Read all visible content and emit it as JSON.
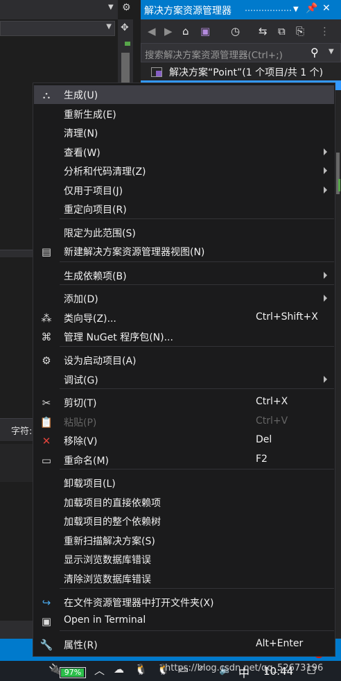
{
  "solution_explorer": {
    "title": "解决方案资源管理器",
    "search_placeholder": "搜索解决方案资源管理器(Ctrl+;)",
    "solution_node": "解决方案“Point”(1 个项目/共 1 个)"
  },
  "bottom_panel": {
    "char_label": "字符:"
  },
  "context_menu": {
    "items": [
      {
        "label": "生成(U)",
        "shortcut": "",
        "submenu": false,
        "icon": "build-icon",
        "disabled": false
      },
      {
        "label": "重新生成(E)",
        "shortcut": "",
        "submenu": false,
        "icon": "",
        "disabled": false
      },
      {
        "label": "清理(N)",
        "shortcut": "",
        "submenu": false,
        "icon": "",
        "disabled": false
      },
      {
        "label": "查看(W)",
        "shortcut": "",
        "submenu": true,
        "icon": "",
        "disabled": false
      },
      {
        "label": "分析和代码清理(Z)",
        "shortcut": "",
        "submenu": true,
        "icon": "",
        "disabled": false
      },
      {
        "label": "仅用于项目(J)",
        "shortcut": "",
        "submenu": true,
        "icon": "",
        "disabled": false
      },
      {
        "label": "重定向项目(R)",
        "shortcut": "",
        "submenu": false,
        "icon": "",
        "disabled": false
      },
      {
        "label": "限定为此范围(S)",
        "shortcut": "",
        "submenu": false,
        "icon": "",
        "disabled": false
      },
      {
        "label": "新建解决方案资源管理器视图(N)",
        "shortcut": "",
        "submenu": false,
        "icon": "new-view-icon",
        "disabled": false
      },
      {
        "label": "生成依赖项(B)",
        "shortcut": "",
        "submenu": true,
        "icon": "",
        "disabled": false
      },
      {
        "label": "添加(D)",
        "shortcut": "",
        "submenu": true,
        "icon": "",
        "disabled": false
      },
      {
        "label": "类向导(Z)...",
        "shortcut": "Ctrl+Shift+X",
        "submenu": false,
        "icon": "class-wizard-icon",
        "disabled": false
      },
      {
        "label": "管理 NuGet 程序包(N)...",
        "shortcut": "",
        "submenu": false,
        "icon": "nuget-icon",
        "disabled": false
      },
      {
        "label": "设为启动项目(A)",
        "shortcut": "",
        "submenu": false,
        "icon": "gear-icon",
        "disabled": false
      },
      {
        "label": "调试(G)",
        "shortcut": "",
        "submenu": true,
        "icon": "",
        "disabled": false
      },
      {
        "label": "剪切(T)",
        "shortcut": "Ctrl+X",
        "submenu": false,
        "icon": "scissors-icon",
        "disabled": false
      },
      {
        "label": "粘贴(P)",
        "shortcut": "Ctrl+V",
        "submenu": false,
        "icon": "paste-icon",
        "disabled": true
      },
      {
        "label": "移除(V)",
        "shortcut": "Del",
        "submenu": false,
        "icon": "remove-icon",
        "disabled": false
      },
      {
        "label": "重命名(M)",
        "shortcut": "F2",
        "submenu": false,
        "icon": "rename-icon",
        "disabled": false
      },
      {
        "label": "卸载项目(L)",
        "shortcut": "",
        "submenu": false,
        "icon": "",
        "disabled": false
      },
      {
        "label": "加载项目的直接依赖项",
        "shortcut": "",
        "submenu": false,
        "icon": "",
        "disabled": false
      },
      {
        "label": "加载项目的整个依赖树",
        "shortcut": "",
        "submenu": false,
        "icon": "",
        "disabled": false
      },
      {
        "label": "重新扫描解决方案(S)",
        "shortcut": "",
        "submenu": false,
        "icon": "",
        "disabled": false
      },
      {
        "label": "显示浏览数据库错误",
        "shortcut": "",
        "submenu": false,
        "icon": "",
        "disabled": false
      },
      {
        "label": "清除浏览数据库错误",
        "shortcut": "",
        "submenu": false,
        "icon": "",
        "disabled": false
      },
      {
        "label": "在文件资源管理器中打开文件夹(X)",
        "shortcut": "",
        "submenu": false,
        "icon": "refresh-arrow-icon",
        "disabled": false
      },
      {
        "label": "Open in Terminal",
        "shortcut": "",
        "submenu": false,
        "icon": "terminal-icon",
        "disabled": false
      },
      {
        "label": "属性(R)",
        "shortcut": "Alt+Enter",
        "submenu": false,
        "icon": "wrench-icon",
        "disabled": false
      }
    ]
  },
  "taskbar": {
    "battery_text": "97%",
    "battery_level": 0.97,
    "language": "中",
    "time": "10:44"
  },
  "watermark": "https://blog.csdn.net/qq_52673196",
  "colors": {
    "accent": "#007acc",
    "menu_bg": "#1b1b1c",
    "highlight": "#3f3f46",
    "battery": "#2cbf4a"
  }
}
